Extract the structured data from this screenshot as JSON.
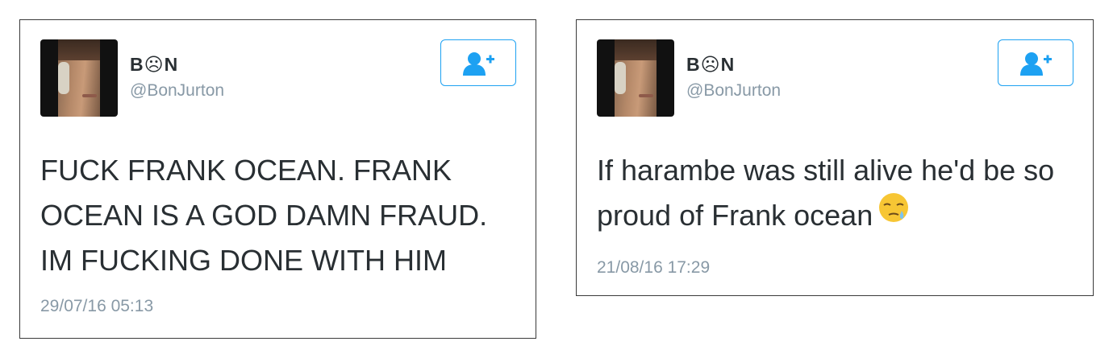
{
  "tweets": [
    {
      "display_name": "B☹N",
      "handle": "@BonJurton",
      "text": "FUCK FRANK OCEAN. FRANK OCEAN IS A GOD DAMN FRAUD. IM FUCKING DONE WITH HIM",
      "timestamp": "29/07/16 05:13",
      "follow_icon": "add-user-icon"
    },
    {
      "display_name": "B☹N",
      "handle": "@BonJurton",
      "text": "If harambe was still alive he'd be so proud of Frank ocean",
      "emoji": "sleepy-face-emoji",
      "timestamp": "21/08/16 17:29",
      "follow_icon": "add-user-icon"
    }
  ],
  "colors": {
    "accent": "#1da1f2",
    "text": "#292f33",
    "muted": "#8899a6",
    "border": "#3a3a3a"
  }
}
